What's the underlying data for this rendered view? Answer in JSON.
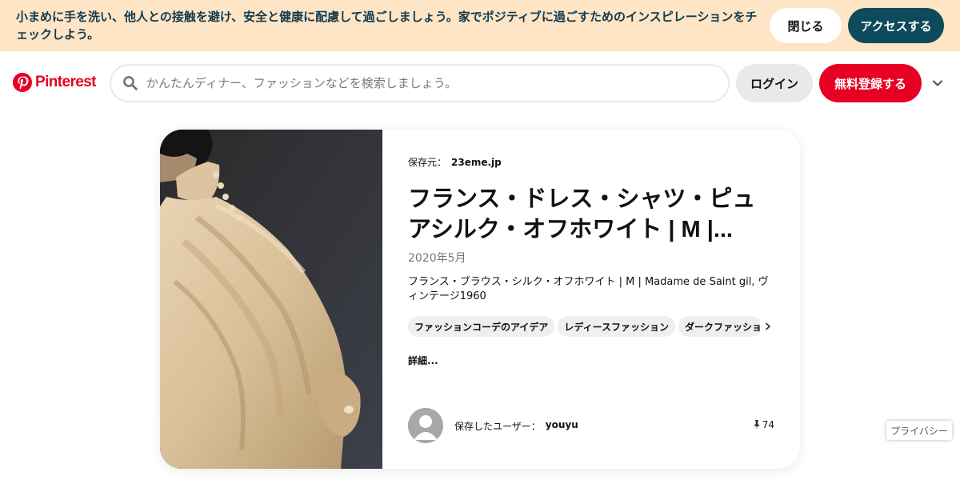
{
  "banner": {
    "message": "小まめに手を洗い、他人との接触を避け、安全と健康に配慮して過ごしましょう。家でポジティブに過ごすためのインスピレーションをチェックしよう。",
    "close_label": "閉じる",
    "access_label": "アクセスする",
    "background": "#fde5c6",
    "text_color": "#133a4e",
    "access_button_color": "#0c4a5c"
  },
  "header": {
    "logo_text": "Pinterest",
    "logo_icon": "pinterest-logo-icon",
    "brand_color": "#e60023",
    "search_icon": "search-icon",
    "search_placeholder": "かんたんディナー、ファッションなどを検索しましょう。",
    "search_value": "",
    "login_label": "ログイン",
    "signup_label": "無料登録する",
    "more_icon": "chevron-down-icon"
  },
  "pin": {
    "source_label": "保存元：",
    "source_domain": "23eme.jp",
    "title": "フランス・ドレス・シャツ・ピュアシルク・オフホワイト | M |...",
    "date": "2020年5月",
    "description": "フランス・ブラウス・シルク・オフホワイト | M | Madame de Saint gil, ヴィンテージ1960",
    "tags": [
      {
        "label": "ファッションコーデのアイデア"
      },
      {
        "label": "レディースファッション"
      },
      {
        "label": "ダークファッション"
      }
    ],
    "tags_next_icon": "chevron-right-icon",
    "more_link": "詳細...",
    "saved_by_label": "保存したユーザー：",
    "saved_by_user": "youyu",
    "save_count_icon": "pushpin-icon",
    "save_count": "74"
  },
  "privacy_label": "プライバシー"
}
